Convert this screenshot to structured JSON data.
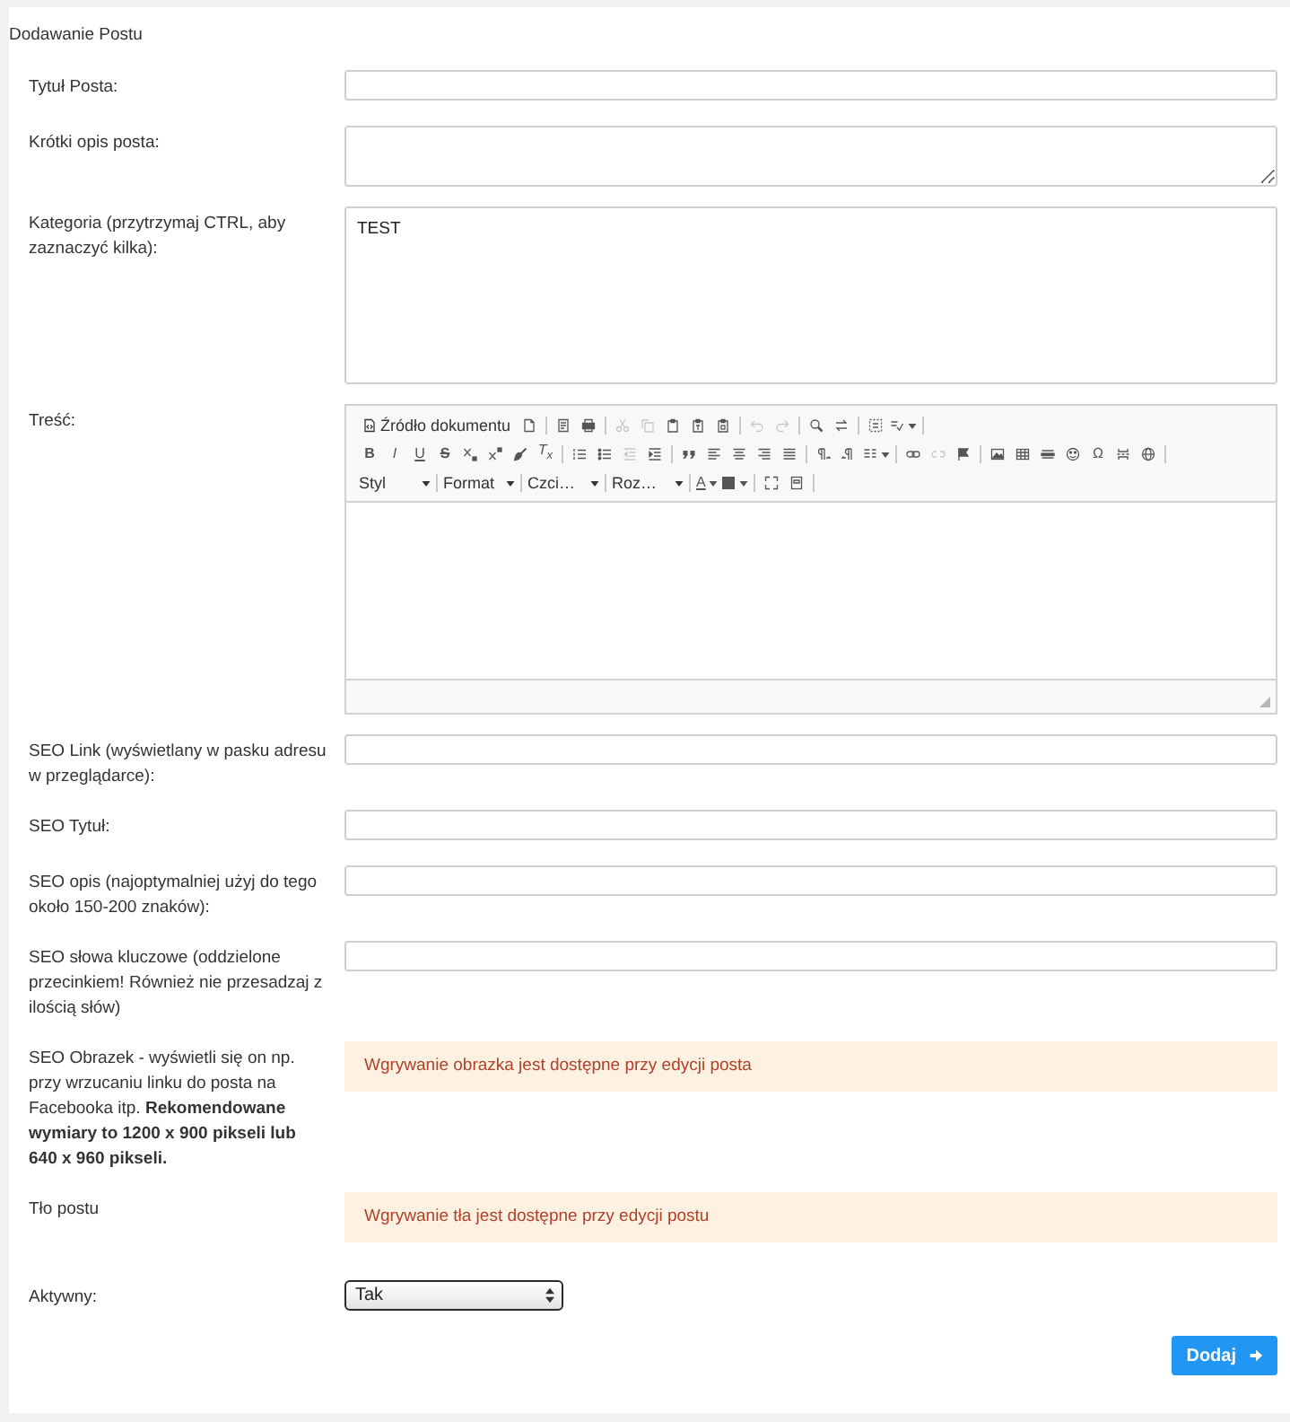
{
  "panel": {
    "title": "Dodawanie Postu"
  },
  "form": {
    "rows": [
      {
        "kind": "input",
        "label": "Tytuł Posta:"
      },
      {
        "kind": "textarea",
        "label": "Krótki opis posta:"
      },
      {
        "kind": "multiselect",
        "label": "Kategoria (przytrzymaj CTRL, aby zaznaczyć kilka):",
        "options": [
          {
            "text": "TEST",
            "selected": false
          }
        ]
      },
      {
        "kind": "editor",
        "label": "Treść:",
        "toolbar": [
          [
            [
              {
                "kind": "source",
                "label": "Źródło dokumentu",
                "disabled": false
              },
              {
                "kind": "newpage",
                "disabled": false
              }
            ],
            [
              {
                "kind": "preview",
                "disabled": false
              },
              {
                "kind": "print",
                "disabled": false
              }
            ],
            [
              {
                "kind": "cut",
                "disabled": true
              },
              {
                "kind": "copy",
                "disabled": true
              },
              {
                "kind": "paste",
                "disabled": false
              },
              {
                "kind": "pastetext",
                "disabled": false
              },
              {
                "kind": "pasteword",
                "disabled": false
              }
            ],
            [
              {
                "kind": "undo",
                "disabled": true
              },
              {
                "kind": "redo",
                "disabled": true
              }
            ],
            [
              {
                "kind": "find",
                "disabled": false
              },
              {
                "kind": "replace",
                "disabled": false
              }
            ],
            [
              {
                "kind": "selectall",
                "disabled": false
              },
              {
                "kind": "spellcheck",
                "disabled": false
              }
            ]
          ],
          [
            [
              {
                "kind": "bold",
                "glyph": "B",
                "disabled": false
              },
              {
                "kind": "italic",
                "glyph": "I",
                "disabled": false
              },
              {
                "kind": "underline",
                "glyph": "U",
                "disabled": false
              },
              {
                "kind": "strike",
                "glyph": "S",
                "disabled": false
              },
              {
                "kind": "subscript",
                "disabled": false
              },
              {
                "kind": "superscript",
                "disabled": false
              },
              {
                "kind": "copyformat",
                "disabled": false
              },
              {
                "kind": "removeformat",
                "glyph": "T$_{x}$",
                "disabled": false
              }
            ],
            [
              {
                "kind": "numlist",
                "disabled": false
              },
              {
                "kind": "bulletlist",
                "disabled": false
              },
              {
                "kind": "outdent",
                "disabled": true
              },
              {
                "kind": "indent",
                "disabled": false
              }
            ],
            [
              {
                "kind": "blockquote",
                "disabled": false
              },
              {
                "kind": "alignleft",
                "disabled": false
              },
              {
                "kind": "aligncenter",
                "disabled": false
              },
              {
                "kind": "alignright",
                "disabled": false
              },
              {
                "kind": "justify",
                "disabled": false
              }
            ],
            [
              {
                "kind": "ltr",
                "disabled": false
              },
              {
                "kind": "rtl",
                "disabled": false
              },
              {
                "kind": "language",
                "disabled": false
              }
            ],
            [
              {
                "kind": "link",
                "disabled": false
              },
              {
                "kind": "unlink",
                "disabled": true
              },
              {
                "kind": "anchor",
                "disabled": false
              }
            ],
            [
              {
                "kind": "image",
                "disabled": false
              },
              {
                "kind": "table",
                "disabled": false
              },
              {
                "kind": "hrule",
                "disabled": false
              },
              {
                "kind": "smiley",
                "disabled": false
              },
              {
                "kind": "specialchar",
                "glyph": "Ω",
                "disabled": false
              },
              {
                "kind": "pagebreak",
                "disabled": false
              },
              {
                "kind": "iframe",
                "disabled": false
              }
            ]
          ],
          [
            [
              {
                "kind": "combo",
                "label": "Styl",
                "disabled": false
              }
            ],
            [
              {
                "kind": "combo",
                "label": "Format",
                "disabled": false
              }
            ],
            [
              {
                "kind": "combo",
                "label": "Czci…",
                "disabled": false
              }
            ],
            [
              {
                "kind": "combo",
                "label": "Roz…",
                "disabled": false
              }
            ],
            [
              {
                "kind": "textcolor",
                "glyph": "A",
                "disabled": false
              },
              {
                "kind": "bgcolor",
                "disabled": false
              }
            ],
            [
              {
                "kind": "maximize",
                "disabled": false
              },
              {
                "kind": "showblocks",
                "disabled": false
              }
            ]
          ]
        ]
      },
      {
        "kind": "input",
        "label": "SEO Link (wyświetlany w pasku adresu w przeglądarce):"
      },
      {
        "kind": "input",
        "label": "SEO Tytuł:"
      },
      {
        "kind": "input",
        "label": "SEO opis (najoptymalniej użyj do tego około 150-200 znaków):"
      },
      {
        "kind": "input",
        "label": "SEO słowa kluczowe (oddzielone przecinkiem! Również nie przesadzaj z ilością słów)"
      },
      {
        "kind": "notice",
        "label": "SEO Obrazek - wyświetli się on np. przy wrzucaniu linku do posta na Facebooka itp. **Rekomendowane wymiary to 1200 x 900 pikseli lub 640 x 960 pikseli.**",
        "text": "Wgrywanie obrazka jest dostępne przy edycji posta"
      },
      {
        "kind": "notice",
        "label": "Tło postu",
        "text": "Wgrywanie tła jest dostępne przy edycji postu"
      },
      {
        "kind": "select",
        "label": "Aktywny:",
        "value": "Tak"
      }
    ],
    "submit": {
      "label": "Dodaj"
    }
  }
}
